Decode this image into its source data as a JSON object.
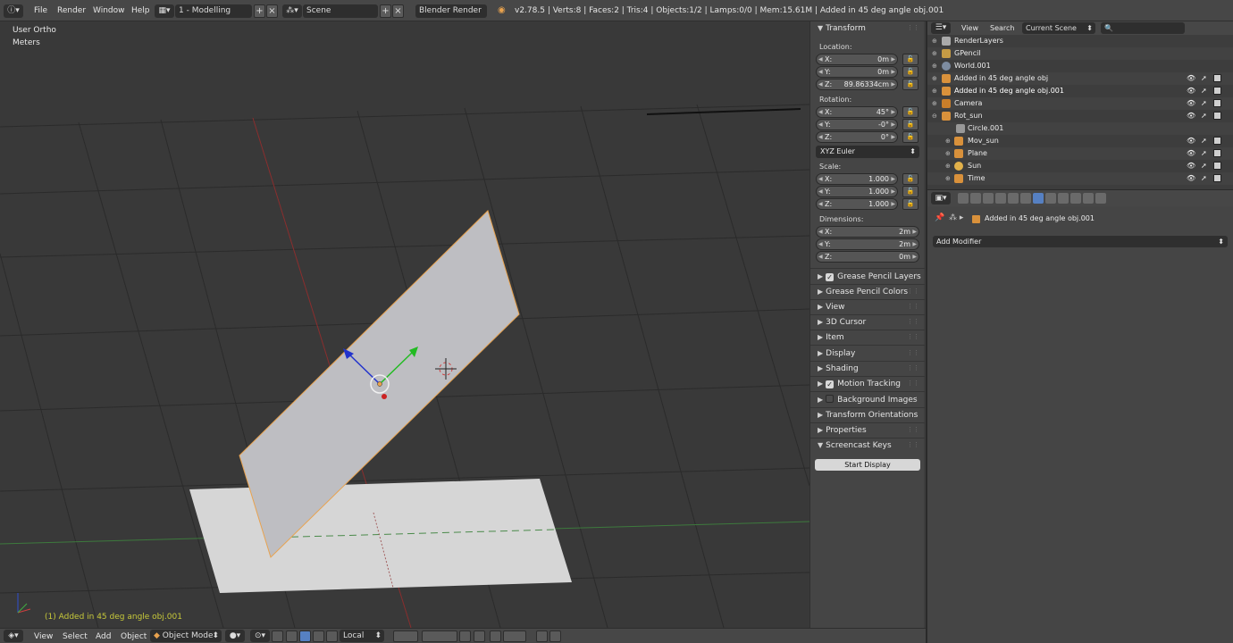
{
  "topbar": {
    "info_icon": "info-icon",
    "menus": [
      "File",
      "Render",
      "Window",
      "Help"
    ],
    "screen_layout": "1 - Modelling",
    "scene": "Scene",
    "render_engine": "Blender Render",
    "stats": "v2.78.5 | Verts:8 | Faces:2 | Tris:4 | Objects:1/2 | Lamps:0/0 | Mem:15.61M | Added in 45 deg angle obj.001"
  },
  "viewport": {
    "view_name": "User Ortho",
    "units": "Meters",
    "active_object_label": "(1) Added in 45 deg angle obj.001"
  },
  "npanel": {
    "transform_title": "Transform",
    "location_label": "Location:",
    "location": [
      {
        "axis": "X:",
        "value": "0m"
      },
      {
        "axis": "Y:",
        "value": "0m"
      },
      {
        "axis": "Z:",
        "value": "89.86334cm"
      }
    ],
    "rotation_label": "Rotation:",
    "rotation": [
      {
        "axis": "X:",
        "value": "45°"
      },
      {
        "axis": "Y:",
        "value": "-0°"
      },
      {
        "axis": "Z:",
        "value": "0°"
      }
    ],
    "rotation_mode": "XYZ Euler",
    "scale_label": "Scale:",
    "scale": [
      {
        "axis": "X:",
        "value": "1.000"
      },
      {
        "axis": "Y:",
        "value": "1.000"
      },
      {
        "axis": "Z:",
        "value": "1.000"
      }
    ],
    "dimensions_label": "Dimensions:",
    "dimensions": [
      {
        "axis": "X:",
        "value": "2m"
      },
      {
        "axis": "Y:",
        "value": "2m"
      },
      {
        "axis": "Z:",
        "value": "0m"
      }
    ],
    "sections": [
      {
        "label": "Grease Pencil Layers",
        "checkbox": true
      },
      {
        "label": "Grease Pencil Colors"
      },
      {
        "label": "View"
      },
      {
        "label": "3D Cursor"
      },
      {
        "label": "Item"
      },
      {
        "label": "Display"
      },
      {
        "label": "Shading"
      },
      {
        "label": "Motion Tracking",
        "checkbox": true
      },
      {
        "label": "Background Images",
        "checkbox": false
      },
      {
        "label": "Transform Orientations"
      },
      {
        "label": "Properties"
      }
    ],
    "screencast_title": "Screencast Keys",
    "start_display": "Start Display"
  },
  "outliner": {
    "menu": [
      "View",
      "Search"
    ],
    "display_mode": "Current Scene",
    "rows": [
      {
        "name": "RenderLayers",
        "indent": 0
      },
      {
        "name": "GPencil",
        "indent": 0
      },
      {
        "name": "World.001",
        "indent": 0
      },
      {
        "name": "Added in 45 deg angle obj",
        "indent": 0
      },
      {
        "name": "Added in 45 deg angle obj.001",
        "indent": 0
      },
      {
        "name": "Camera",
        "indent": 0
      },
      {
        "name": "Rot_sun",
        "indent": 0
      },
      {
        "name": "Circle.001",
        "indent": 1
      },
      {
        "name": "Mov_sun",
        "indent": 1
      },
      {
        "name": "Plane",
        "indent": 1
      },
      {
        "name": "Sun",
        "indent": 1
      },
      {
        "name": "Time",
        "indent": 1
      }
    ]
  },
  "properties": {
    "object_name": "Added in 45 deg angle obj.001",
    "add_modifier": "Add Modifier"
  },
  "bottombar": {
    "menus": [
      "View",
      "Select",
      "Add",
      "Object"
    ],
    "mode": "Object Mode",
    "orientation": "Local"
  },
  "colors": {
    "accent": "#5680c2",
    "selected_outline": "#e8a24e",
    "object_label": "#c7c93a"
  }
}
